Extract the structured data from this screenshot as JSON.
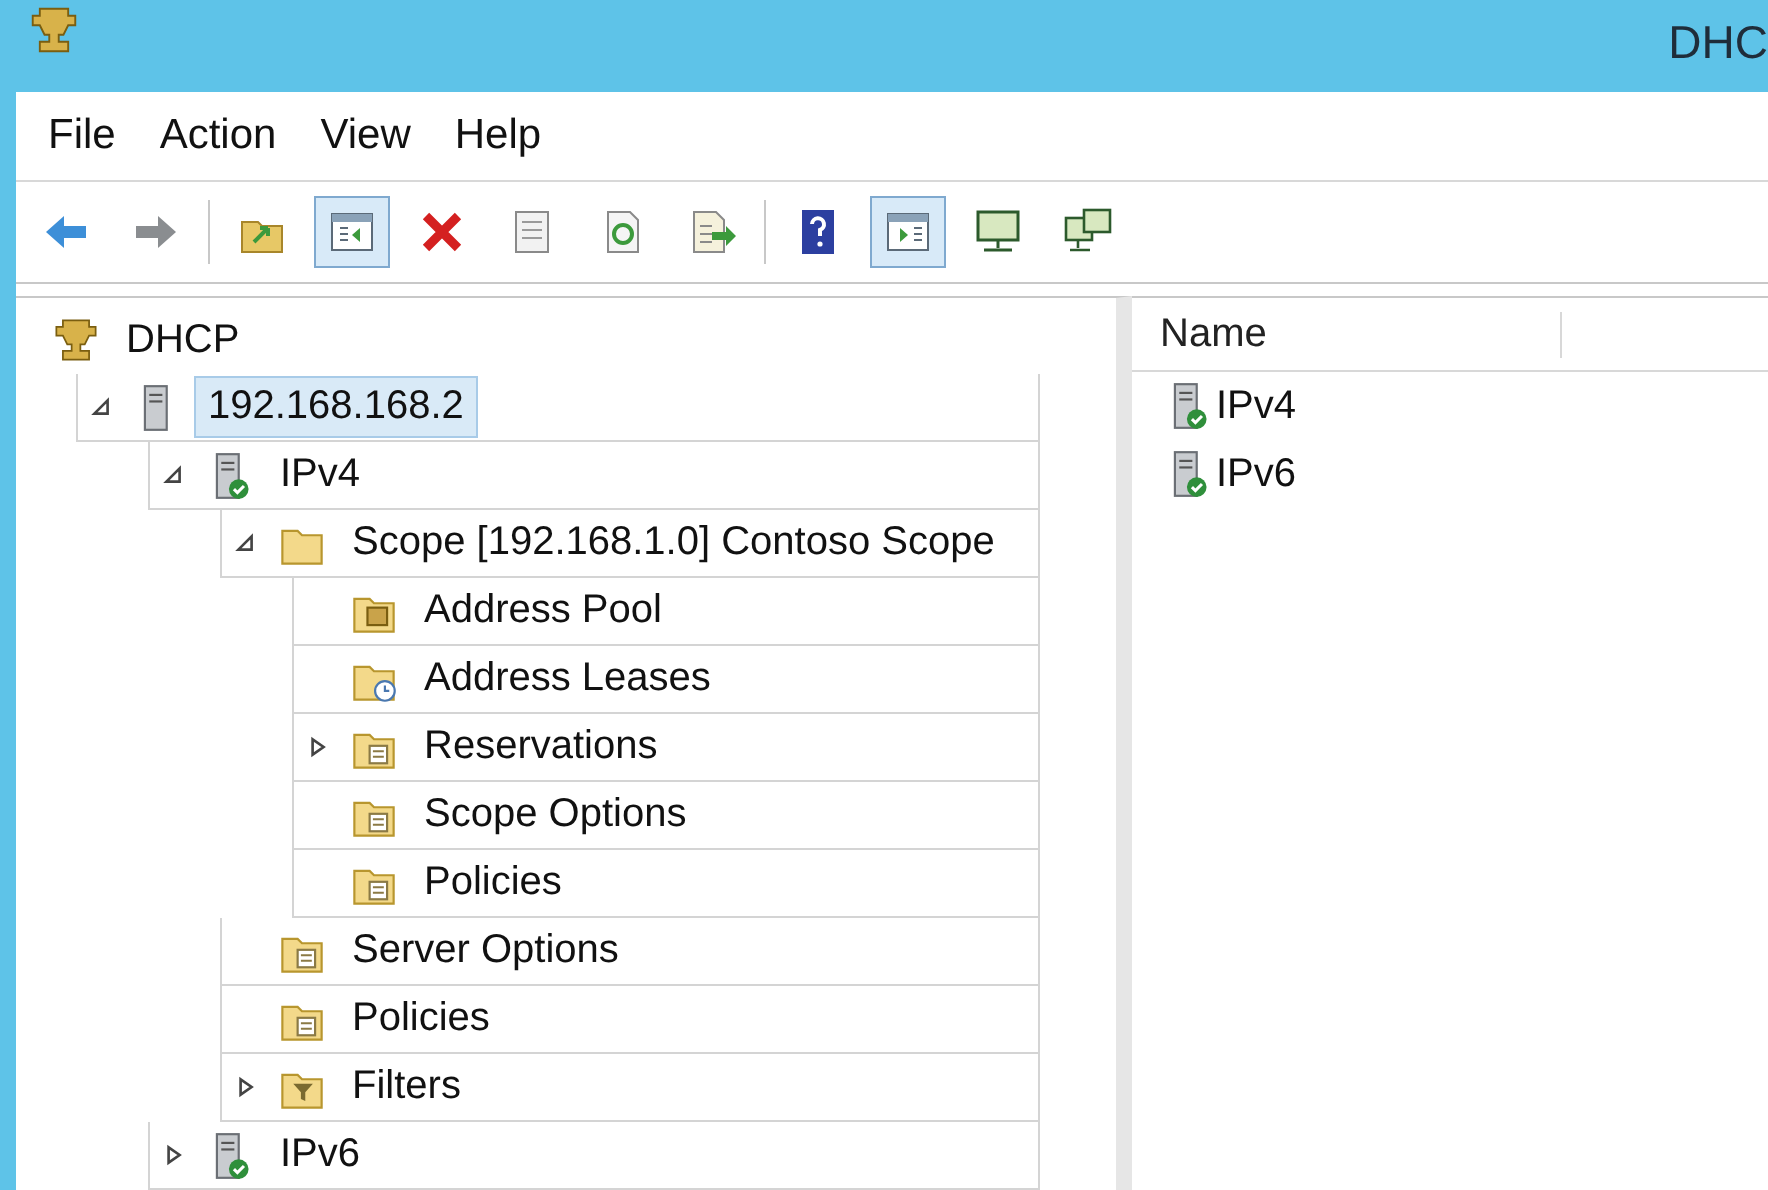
{
  "window": {
    "title": "DHC"
  },
  "menu": [
    {
      "label": "File"
    },
    {
      "label": "Action"
    },
    {
      "label": "View"
    },
    {
      "label": "Help"
    }
  ],
  "toolbar": [
    {
      "kind": "back",
      "pressed": false
    },
    {
      "kind": "forward",
      "pressed": false
    },
    {
      "kind": "separator"
    },
    {
      "kind": "up",
      "pressed": false
    },
    {
      "kind": "tree",
      "pressed": true
    },
    {
      "kind": "delete",
      "pressed": false
    },
    {
      "kind": "properties",
      "pressed": false
    },
    {
      "kind": "refresh",
      "pressed": false
    },
    {
      "kind": "export",
      "pressed": false
    },
    {
      "kind": "separator"
    },
    {
      "kind": "help",
      "pressed": false
    },
    {
      "kind": "actionpane",
      "pressed": true
    },
    {
      "kind": "monitor",
      "pressed": false
    },
    {
      "kind": "monitors",
      "pressed": false
    }
  ],
  "tree": [
    {
      "label": "DHCP",
      "kind": "dhcp",
      "selected": false,
      "children": [
        {
          "label": "192.168.168.2",
          "kind": "server",
          "selected": true,
          "expanded": true,
          "children": [
            {
              "label": "IPv4",
              "kind": "protocol",
              "selected": false,
              "expanded": true,
              "children": [
                {
                  "label": "Scope [192.168.1.0] Contoso Scope",
                  "kind": "folder",
                  "selected": false,
                  "expanded": true,
                  "children": [
                    {
                      "label": "Address Pool",
                      "kind": "pool",
                      "selected": false
                    },
                    {
                      "label": "Address Leases",
                      "kind": "leases",
                      "selected": false
                    },
                    {
                      "label": "Reservations",
                      "kind": "reservations",
                      "selected": false,
                      "expanded": false
                    },
                    {
                      "label": "Scope Options",
                      "kind": "options",
                      "selected": false
                    },
                    {
                      "label": "Policies",
                      "kind": "policies",
                      "selected": false
                    }
                  ]
                },
                {
                  "label": "Server Options",
                  "kind": "options",
                  "selected": false
                },
                {
                  "label": "Policies",
                  "kind": "policies",
                  "selected": false
                },
                {
                  "label": "Filters",
                  "kind": "filters",
                  "selected": false,
                  "expanded": false
                }
              ]
            },
            {
              "label": "IPv6",
              "kind": "protocol",
              "selected": false,
              "expanded": false
            }
          ]
        }
      ]
    }
  ],
  "list": {
    "columns": [
      "Name"
    ],
    "rows": [
      {
        "name": "IPv4",
        "kind": "protocol"
      },
      {
        "name": "IPv6",
        "kind": "protocol"
      }
    ]
  }
}
